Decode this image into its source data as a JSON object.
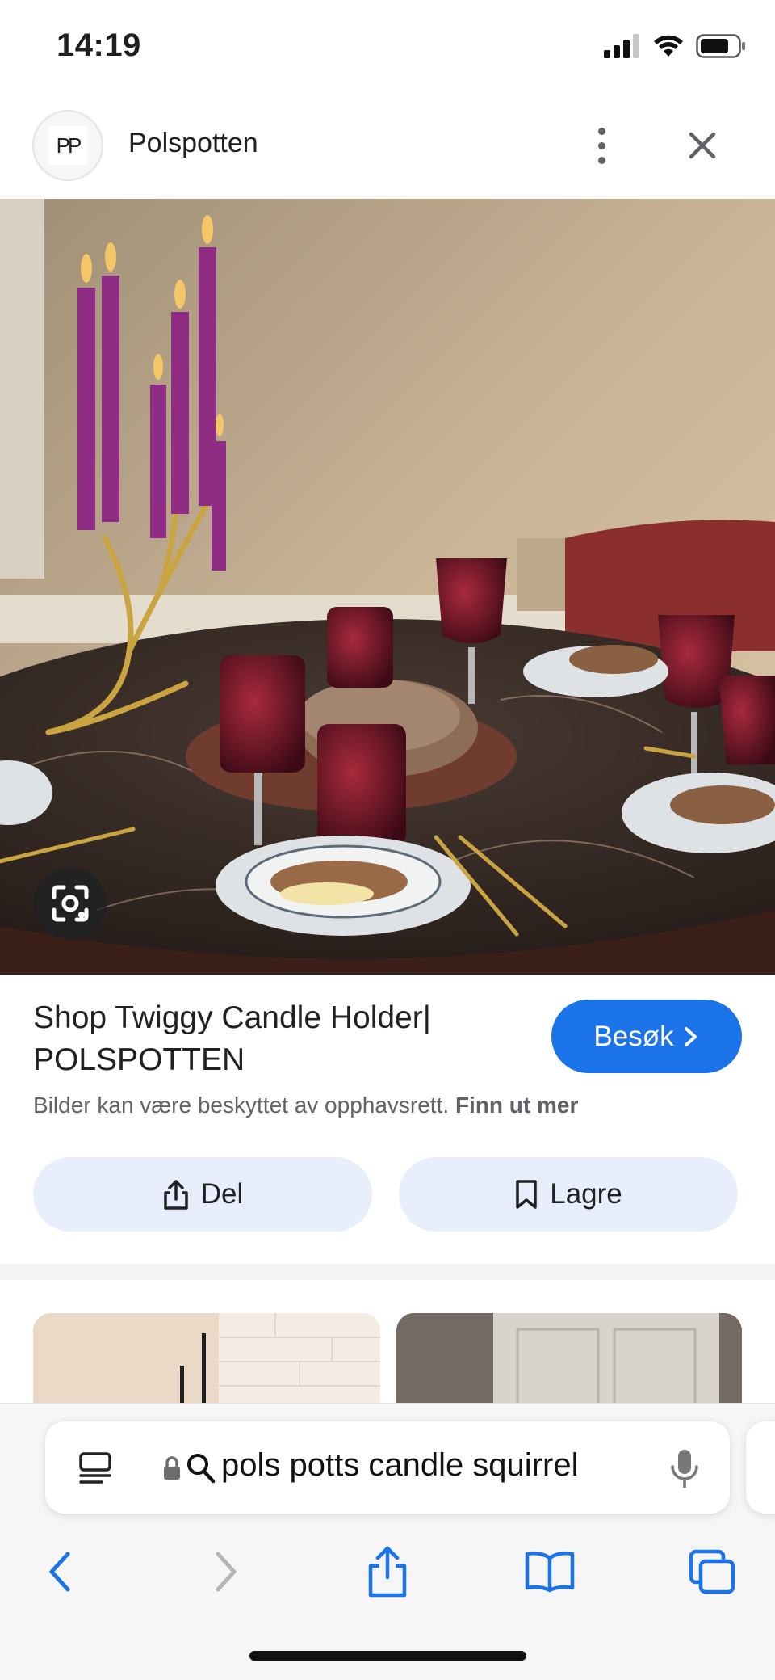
{
  "status_bar": {
    "time": "14:19"
  },
  "site": {
    "logo_text": "PP",
    "name": "Polspotten"
  },
  "result": {
    "title": "Shop Twiggy Candle Holder| POLSPOTTEN",
    "visit_label": "Besøk",
    "copyright_text": "Bilder kan være beskyttet av opphavsrett.",
    "learn_more": "Finn ut mer",
    "share_label": "Del",
    "save_label": "Lagre"
  },
  "browser": {
    "url_text": "pols potts candle squirrel"
  },
  "colors": {
    "accent": "#1a73e8",
    "action_bg": "#e8eefb",
    "text_primary": "#202124",
    "text_secondary": "#5f6368"
  },
  "icons": [
    "signal-icon",
    "wifi-icon",
    "battery-icon",
    "more-vert-icon",
    "close-icon",
    "lens-icon",
    "chevron-right-icon",
    "share-icon",
    "bookmark-icon",
    "reader-icon",
    "lock-icon",
    "search-icon",
    "mic-icon",
    "back-icon",
    "forward-icon",
    "share-page-icon",
    "bookmarks-icon",
    "tabs-icon"
  ]
}
